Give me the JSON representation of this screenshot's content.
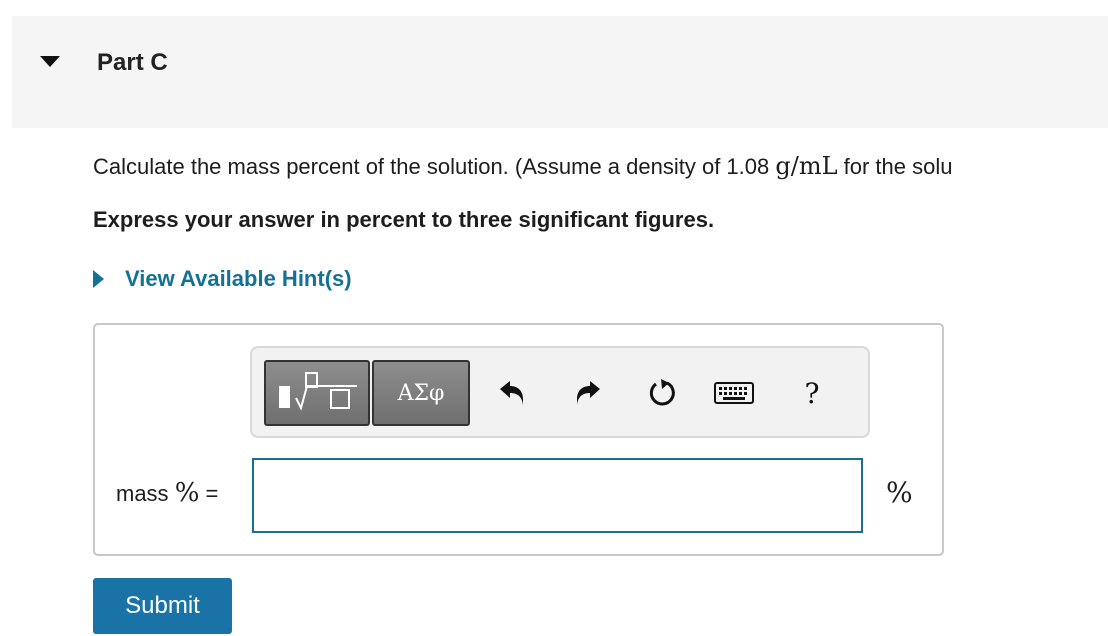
{
  "part": {
    "title": "Part C",
    "collapse_icon": "caret-down-icon"
  },
  "question": {
    "text_before": "Calculate the mass percent of the solution. (Assume a density of 1.08 ",
    "density_unit": "g/mL",
    "text_after": " for the solu"
  },
  "instruction": "Express your answer in percent to three significant figures.",
  "hint": {
    "label": "View Available Hint(s)",
    "icon": "caret-right-icon"
  },
  "toolbar": {
    "templates_icon": "templates-icon",
    "symbols_label": "ΑΣφ",
    "undo_icon": "undo-icon",
    "redo_icon": "redo-icon",
    "reset_icon": "reset-icon",
    "keyboard_icon": "keyboard-icon",
    "help_label": "?"
  },
  "answer": {
    "label_text": "mass",
    "label_symbol": "%",
    "label_equals": "=",
    "value": "",
    "unit": "%"
  },
  "submit_label": "Submit",
  "colors": {
    "accent": "#137196",
    "button": "#1a73a6",
    "header_bg": "#f5f5f5"
  }
}
